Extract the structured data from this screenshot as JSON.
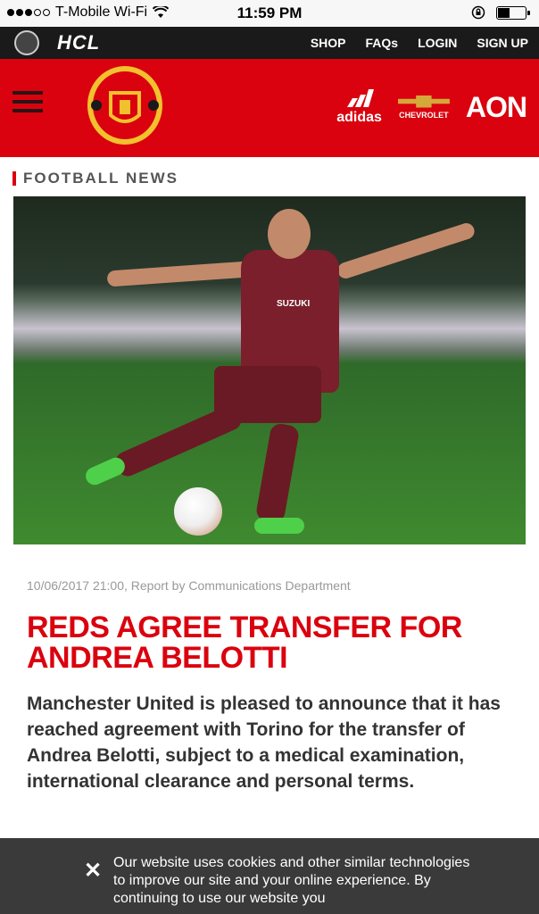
{
  "status_bar": {
    "carrier": "T-Mobile Wi-Fi",
    "time": "11:59 PM"
  },
  "top_nav": {
    "sponsor": "HCL",
    "links": [
      "SHOP",
      "FAQs",
      "LOGIN",
      "SIGN UP"
    ]
  },
  "header": {
    "sponsors": {
      "adidas": "adidas",
      "chevrolet": "CHEVROLET",
      "aon": "AON"
    }
  },
  "section": {
    "label": "FOOTBALL NEWS"
  },
  "article": {
    "meta": "10/06/2017 21:00, Report by Communications Department",
    "headline": "REDS AGREE TRANSFER FOR ANDREA BELOTTI",
    "intro": "Manchester United is pleased to announce that it has reached agreement with Torino for the transfer of Andrea Belotti, subject to a medical examination, international clearance and personal terms.",
    "image_shirt_text": "SUZUKI"
  },
  "cookie": {
    "message": "Our website uses cookies and other similar technologies to improve our site and your online experience. By continuing to use our website you"
  }
}
